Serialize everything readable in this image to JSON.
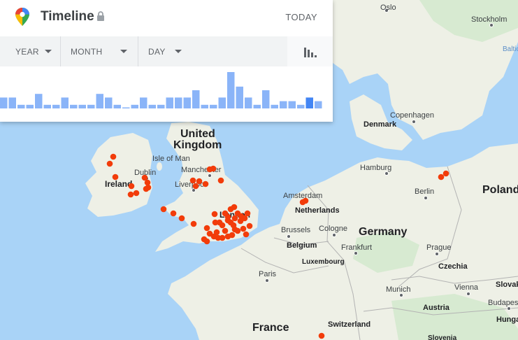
{
  "header": {
    "title": "Timeline",
    "today_label": "TODAY"
  },
  "filters": {
    "year_label": "YEAR",
    "month_label": "MONTH",
    "day_label": "DAY"
  },
  "colors": {
    "sea": "#a9d3f7",
    "land": "#f0efe9",
    "park": "#d7ead1",
    "bar": "#8ab4f8",
    "bar_selected": "#4285f4",
    "point": "#f23c0a"
  },
  "icons": {
    "logo": "maps-pin-icon",
    "lock": "lock-icon",
    "chart": "bar-chart-icon",
    "caret": "chevron-down-icon"
  },
  "histogram": {
    "values": [
      3,
      3,
      1,
      1,
      4,
      1,
      1,
      3,
      1,
      1,
      1,
      4,
      3,
      1,
      0,
      1,
      3,
      1,
      1,
      3,
      3,
      3,
      5,
      1,
      1,
      3,
      10,
      6,
      3,
      1,
      5,
      1,
      2,
      2,
      1,
      3,
      2
    ],
    "selected_indices": [
      35
    ]
  },
  "map": {
    "countries": [
      "United Kingdom",
      "Ireland",
      "Germany",
      "France",
      "Poland",
      "Netherlands",
      "Belgium",
      "Denmark",
      "Luxembourg",
      "Switzerland",
      "Czechia",
      "Austria",
      "Slovakia",
      "Hungary",
      "Slovenia",
      "Isle of Man"
    ],
    "cities": [
      "Oslo",
      "Stockholm",
      "Copenhagen",
      "Hamburg",
      "Berlin",
      "Amsterdam",
      "Brussels",
      "Cologne",
      "Frankfurt",
      "Paris",
      "Prague",
      "Munich",
      "Vienna",
      "Budapest",
      "Dublin",
      "Manchester",
      "Liverpool",
      "London"
    ],
    "seas": [
      "Baltic"
    ]
  }
}
